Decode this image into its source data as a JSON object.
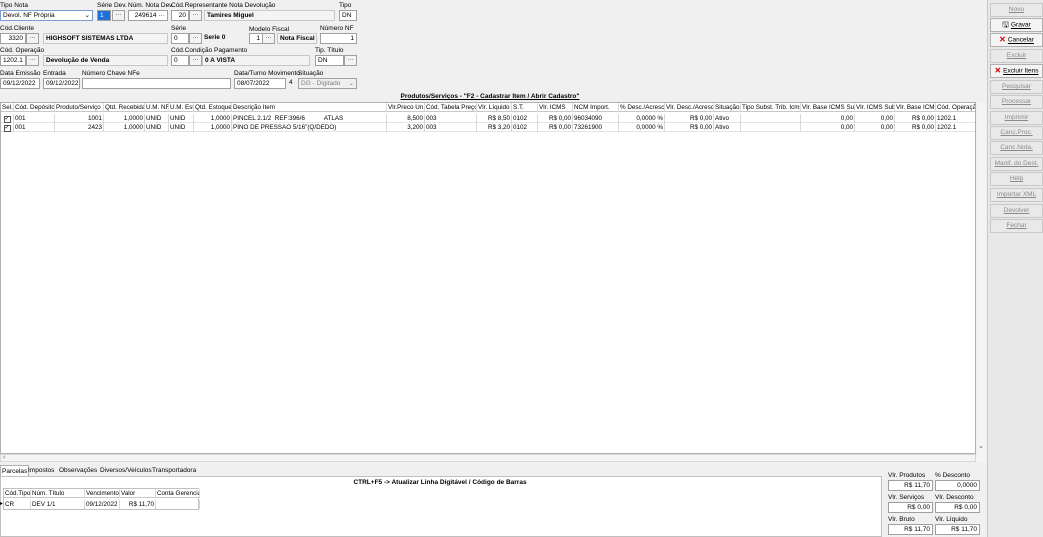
{
  "header": {
    "tipo_nota": {
      "label": "Tipo Nota",
      "value": "Devol. NF Própria"
    },
    "serie_dev": {
      "label": "Série Dev.",
      "value": "1"
    },
    "num_nota_dev": {
      "label": "Núm. Nota Dev.",
      "value": "249614"
    },
    "cod_representante": {
      "label": "Cód.Representante Nota Devolução",
      "code": "20",
      "name": "Tamires Miguel"
    },
    "tipo": {
      "label": "Tipo",
      "value": "DN"
    },
    "cod_cliente": {
      "label": "Cód.Cliente",
      "code": "3320",
      "name": "HIGHSOFT SISTEMAS LTDA"
    },
    "serie": {
      "label": "Série",
      "code": "0",
      "name": "Serie 0"
    },
    "modelo_fiscal": {
      "label": "Modelo Fiscal",
      "code": "1",
      "name": "Nota Fiscal M"
    },
    "numero_nf": {
      "label": "Número NF",
      "value": "1"
    },
    "cod_operacao": {
      "label": "Cód. Operação",
      "code": "1202.1",
      "name": "Devolução de Venda"
    },
    "cod_condicao": {
      "label": "Cód.Condição Pagamento",
      "code": "0",
      "name": "0 A VISTA"
    },
    "tip_titulo": {
      "label": "Tip. Título",
      "value": "DN"
    },
    "data_emissao": {
      "label": "Data Emissão",
      "value": "09/12/2022"
    },
    "entrada": {
      "label": "Entrada",
      "value": "09/12/2022"
    },
    "chave_nfe": {
      "label": "Número Chave NFe",
      "value": ""
    },
    "data_turno": {
      "label": "Data/Turno Movimento",
      "value": "08/07/2022",
      "turno": "4"
    },
    "situacao": {
      "label": "Situação",
      "value": "DG - Digitado"
    }
  },
  "grid_title": "Produtos/Serviços - \"F2 - Cadastrar Item / Abrir Cadastro\"",
  "grid": {
    "columns": [
      "Sel.",
      "Cód. Depósito",
      "Produto/Serviço",
      "Qtd. Recebida",
      "U.M. NF",
      "U.M. Est",
      "Qtd. Estoque",
      "Descrição Item",
      "Vlr.Preco Un.",
      "Cód. Tabela Preço",
      "Vlr. Líquido",
      "S.T.",
      "Vlr. ICMS",
      "NCM Import.",
      "% Desc./Acresc",
      "Vlr. Desc./Acresc",
      "Situação",
      "Tipo Subst. Trib. Icms",
      "Vlr. Base ICMS Sub.",
      "Vlr. ICMS Sub",
      "Vlr. Base ICMS",
      "Cód. Operação"
    ],
    "rows": [
      {
        "sel": "✓",
        "deposito": "001",
        "produto": "1001",
        "qtd_receb": "1,0000",
        "um_nf": "UNID",
        "um_est": "UNID",
        "qtd_est": "1,0000",
        "descricao": "PINCEL 2.1/2  REF:396/6           ATLAS",
        "preco": "8,500",
        "tabela": "003",
        "liquido": "R$ 8,50",
        "st": "0102",
        "icms": "R$ 0,00",
        "ncm": "96034090",
        "desc_pct": "0,0000 %",
        "desc_vlr": "R$ 0,00",
        "situacao": "Ativo",
        "tipo_subst": "",
        "base_sub": "0,00",
        "icms_sub": "0,00",
        "base_icms": "R$ 0,00",
        "cod_op": "1202.1"
      },
      {
        "sel": "✓",
        "deposito": "001",
        "produto": "2423",
        "qtd_receb": "1,0000",
        "um_nf": "UNID",
        "um_est": "UNID",
        "qtd_est": "1,0000",
        "descricao": "PINO DE PRESSAO 5/16\"(Q/DEDO)",
        "preco": "3,200",
        "tabela": "003",
        "liquido": "R$ 3,20",
        "st": "0102",
        "icms": "R$ 0,00",
        "ncm": "73261900",
        "desc_pct": "0,0000 %",
        "desc_vlr": "R$ 0,00",
        "situacao": "Ativo",
        "tipo_subst": "",
        "base_sub": "0,00",
        "icms_sub": "0,00",
        "base_icms": "R$ 0,00",
        "cod_op": "1202.1"
      }
    ]
  },
  "tabs": [
    "Parcelas",
    "Impostos",
    "Observações",
    "Diversos/Veículos",
    "Transportadora"
  ],
  "barcode_hint": "CTRL+F5 -> Atualizar Linha Digitável / Código de Barras",
  "parcelas": {
    "columns": [
      "Cód.Tipo",
      "Núm. Título",
      "Vencimento",
      "Valor",
      "Conta Gerencial"
    ],
    "rows": [
      {
        "tipo": "CR",
        "titulo": "DEV 1/1",
        "venc": "09/12/2022",
        "valor": "R$ 11,70",
        "conta": ""
      }
    ]
  },
  "totals": {
    "vlr_produtos": {
      "label": "Vlr. Produtos",
      "value": "R$ 11,70"
    },
    "pct_desconto": {
      "label": "% Desconto",
      "value": "0,0000"
    },
    "vlr_servicos": {
      "label": "Vlr. Serviços",
      "value": "R$ 0,00"
    },
    "vlr_desconto": {
      "label": "Vlr. Desconto",
      "value": "R$ 0,00"
    },
    "vlr_bruto": {
      "label": "Vlr. Bruto",
      "value": "R$ 11,70"
    },
    "vlr_liquido": {
      "label": "Vlr. Líquido",
      "value": "R$ 11,70"
    }
  },
  "sidebar": {
    "novo": "Novo",
    "gravar": "Gravar",
    "cancelar": "Cancelar",
    "excluir": "Excluir",
    "excluir_itens": "Excluir Itens",
    "pesquisar": "Pesquisar",
    "processar": "Processar",
    "imprimir": "Imprimir",
    "canc_proc": "Canc.Proc.",
    "canc_nota": "Canc.Nota.",
    "manif_dest": "Manif. do Dest.",
    "help": "Help",
    "importar_xml": "Importar XML",
    "devolver": "Devolver",
    "fechar": "Fechar"
  },
  "colors": {
    "accent_red": "#d00000",
    "focus_blue": "#1e6fd9"
  }
}
